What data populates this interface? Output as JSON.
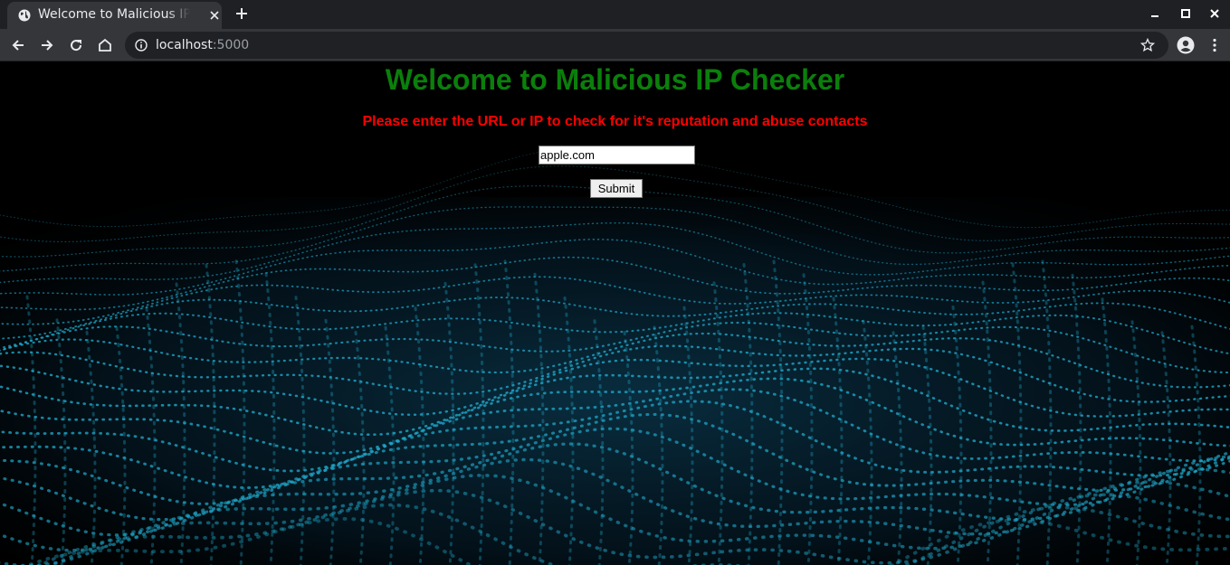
{
  "browser": {
    "tab_title": "Welcome to Malicious IP Checker",
    "url_host": "localhost",
    "url_port": ":5000"
  },
  "page": {
    "title": "Welcome to Malicious IP Checker",
    "subtitle": "Please enter the URL or IP to check for it's reputation and abuse contacts",
    "input_value": "apple.com",
    "submit_label": "Submit"
  },
  "colors": {
    "title": "#0b7f0b",
    "subtitle": "#ff0000",
    "background_wave": "#1fa7c9"
  }
}
